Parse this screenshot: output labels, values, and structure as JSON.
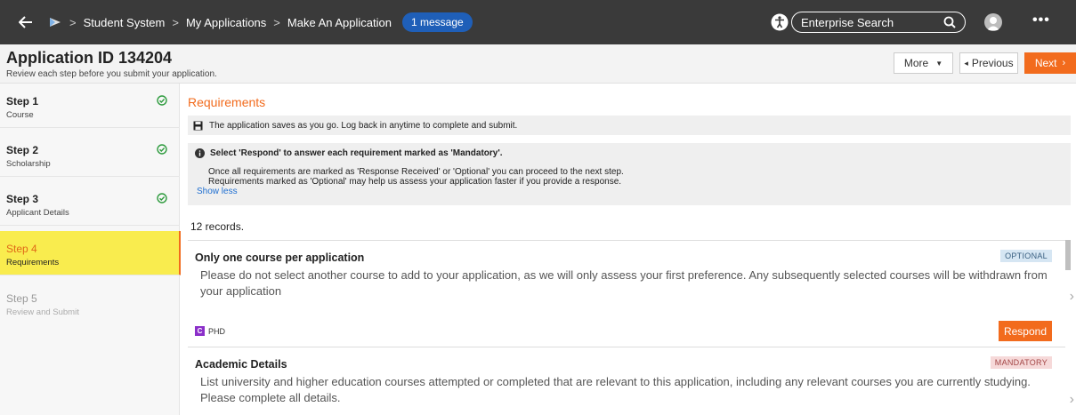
{
  "topbar": {
    "breadcrumbs": [
      "Student System",
      "My Applications",
      "Make An Application"
    ],
    "message_badge": "1 message",
    "search_placeholder": "Enterprise Search",
    "more_menu": "•••"
  },
  "header": {
    "title": "Application ID 134204",
    "subtitle": "Review each step before you submit your application.",
    "more_label": "More",
    "previous_label": "Previous",
    "next_label": "Next"
  },
  "steps": [
    {
      "label": "Step 1",
      "sub": "Course",
      "complete": true
    },
    {
      "label": "Step 2",
      "sub": "Scholarship",
      "complete": true
    },
    {
      "label": "Step 3",
      "sub": "Applicant Details",
      "complete": true
    },
    {
      "label": "Step 4",
      "sub": "Requirements",
      "active": true
    },
    {
      "label": "Step 5",
      "sub": "Review and Submit",
      "disabled": true
    }
  ],
  "main": {
    "section_title": "Requirements",
    "save_note": "The application saves as you go. Log back in anytime to complete and submit.",
    "info_heading": "Select 'Respond' to answer each requirement marked as 'Mandatory'.",
    "info_line1": "Once all requirements are marked as 'Response Received' or 'Optional' you can proceed to the next step.",
    "info_line2": "Requirements marked as 'Optional' may help us assess your application faster if you provide a response.",
    "show_less": "Show less",
    "records": "12 records."
  },
  "cards": [
    {
      "title": "Only one course per application",
      "badge": "OPTIONAL",
      "body": "Please do not select another course to add to your application, as we will only assess your first preference. Any subsequently selected courses will be withdrawn from your application",
      "tag_letter": "C",
      "tag_label": "PHD",
      "respond_label": "Respond"
    },
    {
      "title": "Academic Details",
      "badge": "MANDATORY",
      "body": "List university and higher education courses attempted or completed that are relevant to this application, including any relevant courses you are currently studying. Please complete all details."
    }
  ],
  "colors": {
    "accent": "#f26b1d",
    "topbar": "#3a3a3a",
    "active_step": "#f9ec4e",
    "badge_blue": "#1f5fb8"
  }
}
